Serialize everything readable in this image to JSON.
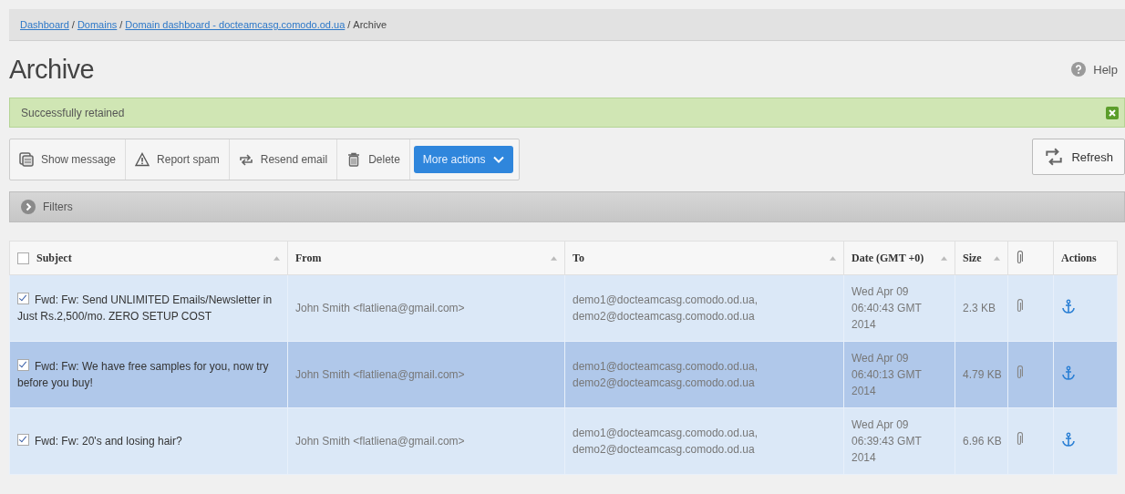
{
  "breadcrumb": [
    {
      "label": "Dashboard",
      "link": true,
      "separator": "/"
    },
    {
      "label": "Domains",
      "link": true,
      "separator": "/"
    },
    {
      "label": "Domain dashboard - docteamcasg.comodo.od.ua",
      "link": true,
      "separator": "/"
    },
    {
      "label": "Archive",
      "link": false
    }
  ],
  "page_title": "Archive",
  "help": "Help",
  "notice": {
    "text": "Successfully retained"
  },
  "toolbar": [
    {
      "kind": "message",
      "label": "Show message"
    },
    {
      "kind": "spam",
      "label": "Report spam"
    },
    {
      "kind": "resend",
      "label": "Resend email"
    },
    {
      "kind": "delete",
      "label": "Delete"
    },
    {
      "kind": "menu",
      "label": "More actions"
    }
  ],
  "refresh": "Refresh",
  "filters": "Filters",
  "table": {
    "select_all_checked": false,
    "columns": [
      {
        "kind": "subject",
        "label": "Subject",
        "sortable": true
      },
      {
        "kind": "from",
        "label": "From",
        "sortable": true
      },
      {
        "kind": "to",
        "label": "To",
        "sortable": true
      },
      {
        "kind": "date",
        "label": "Date (GMT +0)",
        "sortable": true
      },
      {
        "kind": "size",
        "label": "Size",
        "sortable": true
      },
      {
        "kind": "attachment",
        "sortable": false
      },
      {
        "kind": "actions",
        "label": "Actions",
        "sortable": false
      }
    ],
    "rows": [
      {
        "checked": true,
        "selected": false,
        "subject": "Fwd: Fw: Send UNLIMITED Emails/Newsletter in Just Rs.2,500/mo. ZERO SETUP COST",
        "from": "John Smith <flatliena@gmail.com>",
        "to": "demo1@docteamcasg.comodo.od.ua, demo2@docteamcasg.comodo.od.ua",
        "date": "Wed Apr 09 06:40:43 GMT 2014",
        "size": "2.3 KB",
        "attachment": true
      },
      {
        "checked": true,
        "selected": true,
        "subject": "Fwd: Fw: We have free samples for you, now try before you buy!",
        "from": "John Smith <flatliena@gmail.com>",
        "to": "demo1@docteamcasg.comodo.od.ua, demo2@docteamcasg.comodo.od.ua",
        "date": "Wed Apr 09 06:40:13 GMT 2014",
        "size": "4.79 KB",
        "attachment": true
      },
      {
        "checked": true,
        "selected": false,
        "subject": "Fwd: Fw: 20's and losing hair?",
        "from": "John Smith <flatliena@gmail.com>",
        "to": "demo1@docteamcasg.comodo.od.ua, demo2@docteamcasg.comodo.od.ua",
        "date": "Wed Apr 09 06:39:43 GMT 2014",
        "size": "6.96 KB",
        "attachment": true
      }
    ]
  }
}
